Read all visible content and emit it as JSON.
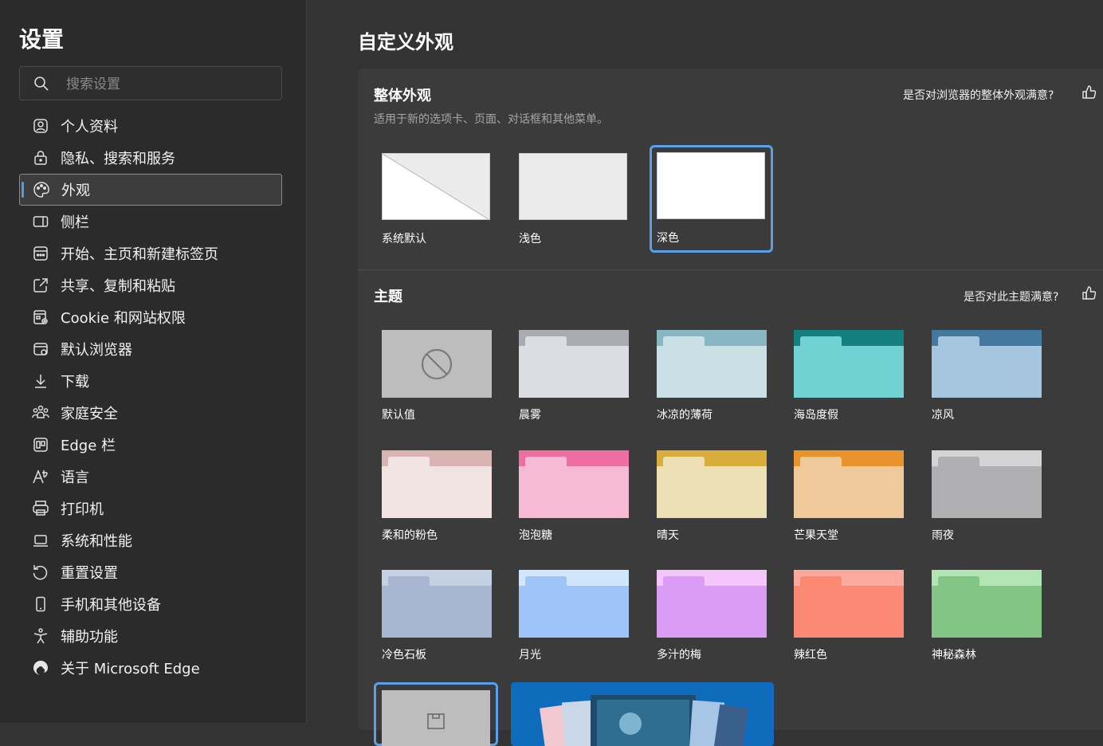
{
  "sidebar": {
    "title": "设置",
    "search": {
      "placeholder": "搜索设置",
      "value": ""
    },
    "items": [
      {
        "label": "个人资料",
        "icon": "profile-icon"
      },
      {
        "label": "隐私、搜索和服务",
        "icon": "lock-icon"
      },
      {
        "label": "外观",
        "icon": "palette-icon",
        "active": true
      },
      {
        "label": "侧栏",
        "icon": "sidebar-icon"
      },
      {
        "label": "开始、主页和新建标签页",
        "icon": "home-tabs-icon"
      },
      {
        "label": "共享、复制和粘贴",
        "icon": "share-icon"
      },
      {
        "label": "Cookie 和网站权限",
        "icon": "cookie-permissions-icon"
      },
      {
        "label": "默认浏览器",
        "icon": "browser-icon"
      },
      {
        "label": "下载",
        "icon": "download-icon"
      },
      {
        "label": "家庭安全",
        "icon": "family-icon"
      },
      {
        "label": "Edge 栏",
        "icon": "edge-bar-icon"
      },
      {
        "label": "语言",
        "icon": "language-icon"
      },
      {
        "label": "打印机",
        "icon": "printer-icon"
      },
      {
        "label": "系统和性能",
        "icon": "laptop-icon"
      },
      {
        "label": "重置设置",
        "icon": "reset-icon"
      },
      {
        "label": "手机和其他设备",
        "icon": "phone-icon"
      },
      {
        "label": "辅助功能",
        "icon": "accessibility-icon"
      },
      {
        "label": "关于 Microsoft Edge",
        "icon": "edge-logo-icon"
      }
    ]
  },
  "main": {
    "title": "自定义外观",
    "overall": {
      "title": "整体外观",
      "description": "适用于新的选项卡、页面、对话框和其他菜单。",
      "feedback": "是否对浏览器的整体外观满意?",
      "options": [
        {
          "label": "系统默认",
          "icon": "system-default-preview"
        },
        {
          "label": "浅色",
          "icon": "light-preview"
        },
        {
          "label": "深色",
          "icon": "dark-preview",
          "selected": true
        }
      ]
    },
    "themes": {
      "title": "主题",
      "feedback": "是否对此主题满意?",
      "items": [
        {
          "label": "默认值",
          "icon": "no-theme-icon",
          "band": "#bdbdbd",
          "body": "#bdbdbd"
        },
        {
          "label": "晨雾",
          "band": "#a9abb2",
          "body": "#dcdde2"
        },
        {
          "label": "冰凉的薄荷",
          "band": "#86b7c2",
          "body": "#c9e0e5"
        },
        {
          "label": "海岛度假",
          "band": "#157f7f",
          "body": "#72d1d2"
        },
        {
          "label": "凉风",
          "band": "#43789f",
          "body": "#a6c6e0"
        },
        {
          "label": "柔和的粉色",
          "band": "#d8b5b3",
          "body": "#f2e3e3"
        },
        {
          "label": "泡泡糖",
          "band": "#ee6ea1",
          "body": "#f7bad4"
        },
        {
          "label": "晴天",
          "band": "#d7ae3c",
          "body": "#ecdfb5"
        },
        {
          "label": "芒果天堂",
          "band": "#e9932d",
          "body": "#f0c99b"
        },
        {
          "label": "雨夜",
          "band": "#d4d4d7",
          "body": "#b0b0b3"
        },
        {
          "label": "冷色石板",
          "band": "#c4d0e3",
          "body": "#a8b6d1"
        },
        {
          "label": "月光",
          "band": "#cfe6fb",
          "body": "#9fc4f8"
        },
        {
          "label": "多汁的梅",
          "band": "#f5c6fb",
          "body": "#db9cf6"
        },
        {
          "label": "辣红色",
          "band": "#fba99c",
          "body": "#fb8873"
        },
        {
          "label": "神秘森林",
          "band": "#b2e5b3",
          "body": "#82c585"
        }
      ]
    }
  },
  "colors": {
    "accent": "#5aa0e6",
    "background": "#333333",
    "sidebar": "#2b2b2b",
    "card": "#3b3b3b"
  }
}
